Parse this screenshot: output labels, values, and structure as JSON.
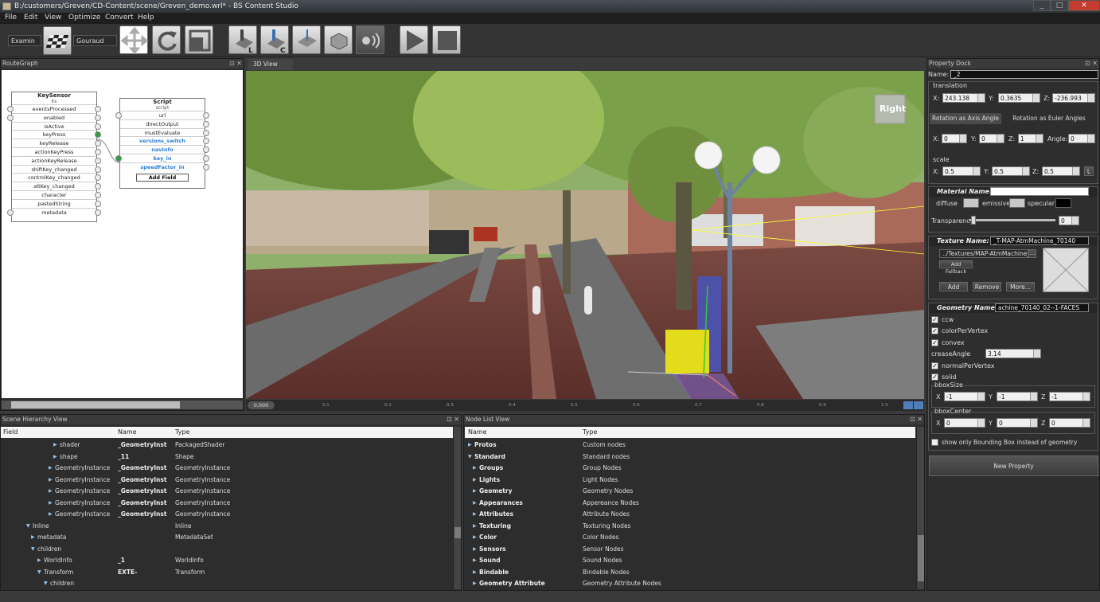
{
  "window": {
    "title": "B:/customers/Greven/CD-Content/scene/Greven_demo.wrl* - BS Content Studio",
    "minimize": "_",
    "maximize": "□",
    "close": "✕"
  },
  "menu": [
    "File",
    "Edit",
    "View",
    "Optimize",
    "Convert",
    "Help"
  ],
  "toolbar": {
    "nav_mode": "Examin",
    "shading": "Gouraud"
  },
  "routegraph": {
    "title": "RouteGraph",
    "close": "⊡ ✕",
    "keysensor": {
      "title": "KeySensor",
      "sub": "ks",
      "fields": [
        "eventsProcessed",
        "enabled",
        "isActive",
        "keyPress",
        "keyRelease",
        "actionKeyPress",
        "actionKeyRelease",
        "shiftKey_changed",
        "controlKey_changed",
        "altKey_changed",
        "character",
        "pastedString",
        "metadata"
      ]
    },
    "script": {
      "title": "Script",
      "sub": "script",
      "fields": [
        "url",
        "directOutput",
        "mustEvaluate",
        "versions_switch",
        "navInfo",
        "key_in",
        "speedFactor_in"
      ],
      "add_field": "Add Field"
    }
  },
  "view3d": {
    "tab": "3D View",
    "nav_cube": "Right"
  },
  "timeline": {
    "time": "0.000",
    "ticks": [
      "0.1",
      "0.2",
      "0.3",
      "0.4",
      "0.5",
      "0.6",
      "0.7",
      "0.8",
      "0.9",
      "1.0"
    ]
  },
  "scene_hierarchy": {
    "title": "Scene Hierarchy View",
    "cols": [
      "Field",
      "Name",
      "Type"
    ],
    "rows": [
      {
        "field": "shader",
        "name": "_GeometryInst",
        "type": "PackagedShader",
        "indent": 66
      },
      {
        "field": "shape",
        "name": "_11",
        "type": "Shape",
        "indent": 66
      },
      {
        "field": "GeometryInstance",
        "name": "_GeometryInst",
        "type": "GeometryInstance",
        "indent": 60
      },
      {
        "field": "GeometryInstance",
        "name": "_GeometryInst",
        "type": "GeometryInstance",
        "indent": 60
      },
      {
        "field": "GeometryInstance",
        "name": "_GeometryInst",
        "type": "GeometryInstance",
        "indent": 60
      },
      {
        "field": "GeometryInstance",
        "name": "_GeometryInst",
        "type": "GeometryInstance",
        "indent": 60
      },
      {
        "field": "GeometryInstance",
        "name": "_GeometryInst",
        "type": "GeometryInstance",
        "indent": 60
      },
      {
        "field": "Inline",
        "name": "",
        "type": "Inline",
        "indent": 32
      },
      {
        "field": "metadata",
        "name": "",
        "type": "MetadataSet",
        "indent": 38
      },
      {
        "field": "children",
        "name": "",
        "type": "",
        "indent": 38
      },
      {
        "field": "WorldInfo",
        "name": "_1",
        "type": "WorldInfo",
        "indent": 46
      },
      {
        "field": "Transform",
        "name": "EXTE-",
        "type": "Transform",
        "indent": 46
      },
      {
        "field": "children",
        "name": "",
        "type": "",
        "indent": 54
      }
    ]
  },
  "node_list": {
    "title": "Node List View",
    "cols": [
      "Name",
      "Type"
    ],
    "rows": [
      {
        "name": "Protos",
        "type": "Custom nodes",
        "indent": 4
      },
      {
        "name": "Standard",
        "type": "Standard nodes",
        "indent": 4
      },
      {
        "name": "Groups",
        "type": "Group Nodes",
        "indent": 10
      },
      {
        "name": "Lights",
        "type": "Light Nodes",
        "indent": 10
      },
      {
        "name": "Geometry",
        "type": "Geometry Nodes",
        "indent": 10
      },
      {
        "name": "Appearances",
        "type": "Appereance Nodes",
        "indent": 10
      },
      {
        "name": "Attributes",
        "type": "Attribute Nodes",
        "indent": 10
      },
      {
        "name": "Texturing",
        "type": "Texturing Nodes",
        "indent": 10
      },
      {
        "name": "Color",
        "type": "Color Nodes",
        "indent": 10
      },
      {
        "name": "Sensors",
        "type": "Sensor Nodes",
        "indent": 10
      },
      {
        "name": "Sound",
        "type": "Sound Nodes",
        "indent": 10
      },
      {
        "name": "Bindable",
        "type": "Bindable Nodes",
        "indent": 10
      },
      {
        "name": "Geometry Attribute",
        "type": "Geometry Attribute Nodes",
        "indent": 10
      }
    ]
  },
  "property_dock": {
    "title": "Property Dock",
    "name_label": "Name:",
    "name_value": "_2",
    "translation": {
      "label": "translation",
      "x": "243.138",
      "y": "0.3635",
      "z": "-236.993"
    },
    "rot_tabs": [
      "Rotation as Axis Angle",
      "Rotation as Euler Angles"
    ],
    "rotation": {
      "x": "0",
      "y": "0",
      "z": "1",
      "angle": "0",
      "angle_label": "Angle:"
    },
    "scale": {
      "label": "scale",
      "x": "0.5",
      "y": "0.5",
      "z": "0.5",
      "lock": "L"
    },
    "material": {
      "label": "Material Name:",
      "diffuse": "diffuse",
      "emissive": "emissive",
      "specular": "specular",
      "transparency": "Transparency",
      "transparency_value": "0",
      "transparency_fraction": 0.02
    },
    "texture": {
      "label": "Texture Name:",
      "value": "_T-MAP-AtmMachine_70140",
      "url": "../Textures/MAP-AtmMachine_7",
      "browse": "...",
      "fallback": "Add Fallback",
      "add": "Add",
      "remove": "Remove",
      "more": "More..."
    },
    "geometry": {
      "label": "Geometry Name:",
      "value": "achine_70140_02--1-FACES",
      "ccw": "ccw",
      "colorPerVertex": "colorPerVertex",
      "convex": "convex",
      "creaseAngle": "creaseAngle",
      "crease_value": "3.14",
      "normalPerVertex": "normalPerVertex",
      "solid": "solid",
      "bboxSize": "bboxSize",
      "bbox_size": {
        "x": "-1",
        "y": "-1",
        "z": "-1"
      },
      "bboxCenter": "bboxCenter",
      "bbox_center": {
        "x": "0",
        "y": "0",
        "z": "0"
      },
      "bbox_only": "show only Bounding Box instead of geometry"
    },
    "new_property": "New Property"
  },
  "axis": {
    "x": "X:",
    "y": "Y:",
    "z": "Z:",
    "X": "X",
    "Y": "Y",
    "Z": "Z"
  },
  "colors": {
    "material_diffuse": "#c8c8c8",
    "material_emissive": "#c8c8c8",
    "material_specular": "#000000"
  }
}
